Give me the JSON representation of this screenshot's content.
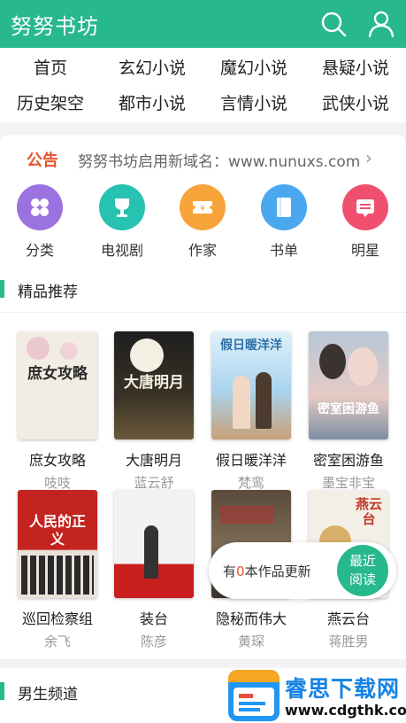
{
  "header": {
    "brand": "努努书坊",
    "search_icon": "search-icon",
    "user_icon": "user-icon",
    "accent": "#27b88c"
  },
  "nav": {
    "items": [
      {
        "label": "首页"
      },
      {
        "label": "玄幻小说"
      },
      {
        "label": "魔幻小说"
      },
      {
        "label": "悬疑小说"
      },
      {
        "label": "历史架空"
      },
      {
        "label": "都市小说"
      },
      {
        "label": "言情小说"
      },
      {
        "label": "武侠小说"
      }
    ]
  },
  "notice": {
    "tag": "公告",
    "text": "努努书坊启用新域名：www.nunuxs.com",
    "arrow": "›"
  },
  "quick": {
    "items": [
      {
        "label": "分类",
        "icon": "category-icon",
        "color": "#9a73e0"
      },
      {
        "label": "电视剧",
        "icon": "trophy-icon",
        "color": "#27c2b0"
      },
      {
        "label": "作家",
        "icon": "ticket-icon",
        "color": "#f6a43a"
      },
      {
        "label": "书单",
        "icon": "book-icon",
        "color": "#4aa8ef"
      },
      {
        "label": "明星",
        "icon": "star-badge-icon",
        "color": "#f0506e"
      }
    ]
  },
  "featured": {
    "title": "精品推荐",
    "books": [
      {
        "title": "庶女攻略",
        "author": "吱吱",
        "cover_text": "庶女攻略"
      },
      {
        "title": "大唐明月",
        "author": "蓝云舒",
        "cover_text": "大唐明月"
      },
      {
        "title": "假日暖洋洋",
        "author": "梵鸾",
        "cover_text": "假日暖洋洋"
      },
      {
        "title": "密室困游鱼",
        "author": "墨宝非宝",
        "cover_text": "密室困游鱼"
      },
      {
        "title": "巡回检察组",
        "author": "余飞",
        "cover_text": "人民的正义"
      },
      {
        "title": "装台",
        "author": "陈彦",
        "cover_text": ""
      },
      {
        "title": "隐秘而伟大",
        "author": "黄琛",
        "cover_text": ""
      },
      {
        "title": "燕云台",
        "author": "蒋胜男",
        "cover_text": "燕云台"
      }
    ]
  },
  "update_pill": {
    "prefix": "有",
    "count": "0",
    "suffix": "本作品更新",
    "recent_label_1": "最近",
    "recent_label_2": "阅读"
  },
  "male_channel": {
    "title": "男生频道"
  },
  "watermark": {
    "title": "睿思下载网",
    "url": "www.cdgthk.com"
  }
}
